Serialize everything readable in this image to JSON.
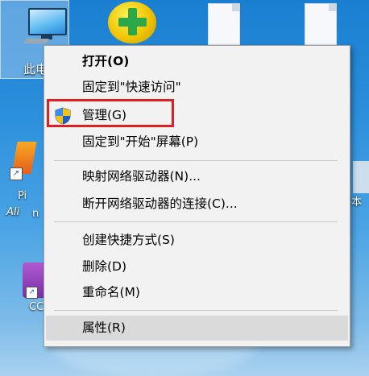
{
  "desktop": {
    "pc_label": "此电",
    "left_shortcut_text_1": "Pi",
    "left_shortcut_text_2": "Ali",
    "left_shortcut_text_3": "n",
    "purple_label": "CC",
    "right_label": "本"
  },
  "menu": {
    "items": [
      {
        "label": "打开(O)",
        "bold": true
      },
      {
        "label": "固定到\"快速访问\""
      },
      {
        "label": "管理(G)",
        "icon": "uac-shield-icon"
      },
      {
        "label": "固定到\"开始\"屏幕(P)"
      },
      {
        "label": "映射网络驱动器(N)..."
      },
      {
        "label": "断开网络驱动器的连接(C)..."
      },
      {
        "label": "创建快捷方式(S)"
      },
      {
        "label": "删除(D)"
      },
      {
        "label": "重命名(M)"
      },
      {
        "label": "属性(R)",
        "hovered": true
      }
    ]
  },
  "colors": {
    "highlight": "#e02020",
    "menu_bg": "#f2f2f2",
    "hover_bg": "#dadada"
  }
}
